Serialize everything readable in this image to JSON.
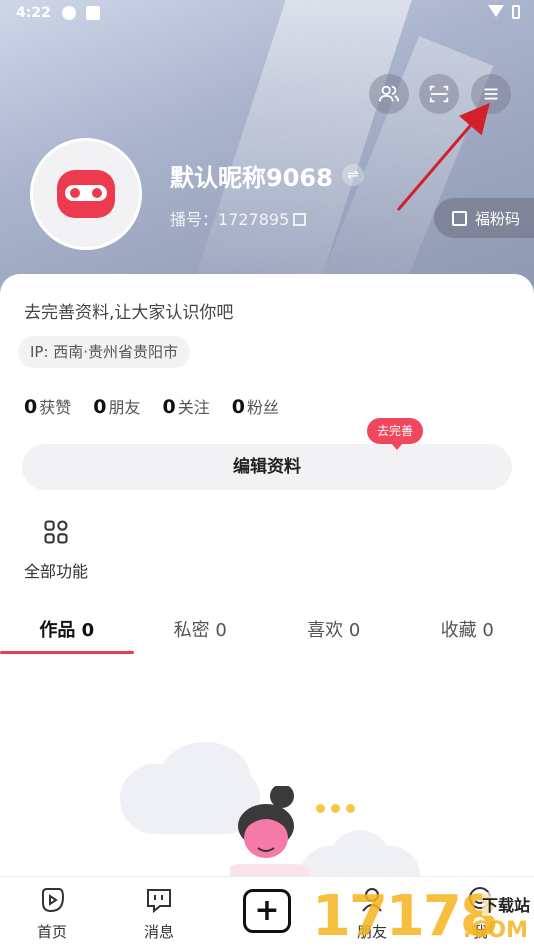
{
  "status_bar": {
    "time": "4:22"
  },
  "header": {
    "nickname": "默认昵称9068",
    "id_label": "播号：",
    "id_value": "1727895",
    "fan_code_label": "福粉码",
    "icons": [
      "friends-icon",
      "scan-icon",
      "menu-icon"
    ]
  },
  "profile": {
    "bio_placeholder": "去完善资料,让大家认识你吧",
    "ip_location": "IP: 西南·贵州省贵阳市",
    "stats": [
      {
        "count": "0",
        "label": "获赞"
      },
      {
        "count": "0",
        "label": "朋友"
      },
      {
        "count": "0",
        "label": "关注"
      },
      {
        "count": "0",
        "label": "粉丝"
      }
    ],
    "complete_tip": "去完善",
    "edit_button": "编辑资料",
    "all_functions": "全部功能"
  },
  "tabs": [
    {
      "label": "作品 0",
      "active": true
    },
    {
      "label": "私密 0",
      "active": false
    },
    {
      "label": "喜欢 0",
      "active": false
    },
    {
      "label": "收藏 0",
      "active": false
    }
  ],
  "bottom_nav": [
    {
      "label": "首页",
      "icon": "home-play-icon"
    },
    {
      "label": "消息",
      "icon": "message-icon"
    },
    {
      "label": "",
      "icon": "add-icon"
    },
    {
      "label": "朋友",
      "icon": "friends-icon"
    },
    {
      "label": "我",
      "icon": "me-icon"
    }
  ],
  "watermark": {
    "digits": "17178",
    "site": "下载站",
    "domain": ".COM"
  },
  "colors": {
    "accent": "#ee3a4f",
    "tooltip": "#f1475c",
    "arrow": "#d3212c"
  }
}
